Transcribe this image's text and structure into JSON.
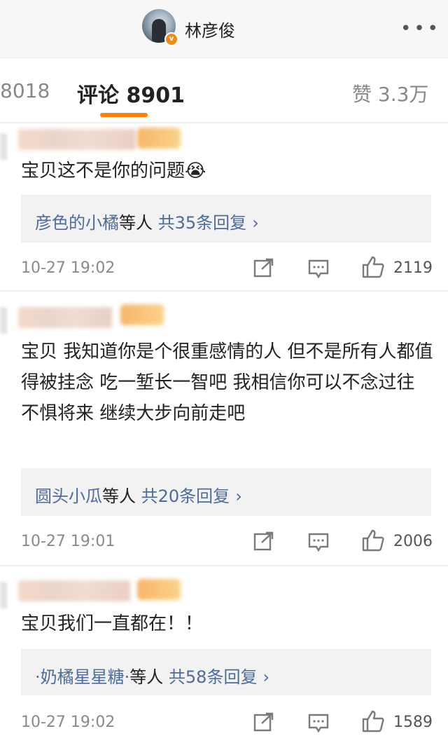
{
  "header": {
    "user_name": "林彦俊",
    "more_icon": "more-dots-icon"
  },
  "tabs": {
    "left_count": "8018",
    "active_label": "评论 8901",
    "likes_label": "赞 3.3万"
  },
  "colors": {
    "accent": "#ff8200",
    "link": "#4d6b9b",
    "verified": "#f08a1c"
  },
  "comments": [
    {
      "text": "宝贝这不是你的问题😭",
      "reply_users": "彦色的小橘",
      "reply_etc": "等人",
      "reply_count": "共35条回复",
      "time": "10-27 19:02",
      "likes": "2119"
    },
    {
      "text": "宝贝  我知道你是个很重感情的人  但不是所有人都值得被挂念  吃一堑长一智吧  我相信你可以不念过往 不惧将来  继续大步向前走吧",
      "reply_users": "圆头小瓜",
      "reply_etc": "等人",
      "reply_count": "共20条回复",
      "time": "10-27 19:01",
      "likes": "2006"
    },
    {
      "text": "宝贝我们一直都在！！",
      "reply_users": "·奶橘星星糖·",
      "reply_etc": "等人",
      "reply_count": "共58条回复",
      "time": "10-27 19:02",
      "likes": "1589"
    }
  ]
}
